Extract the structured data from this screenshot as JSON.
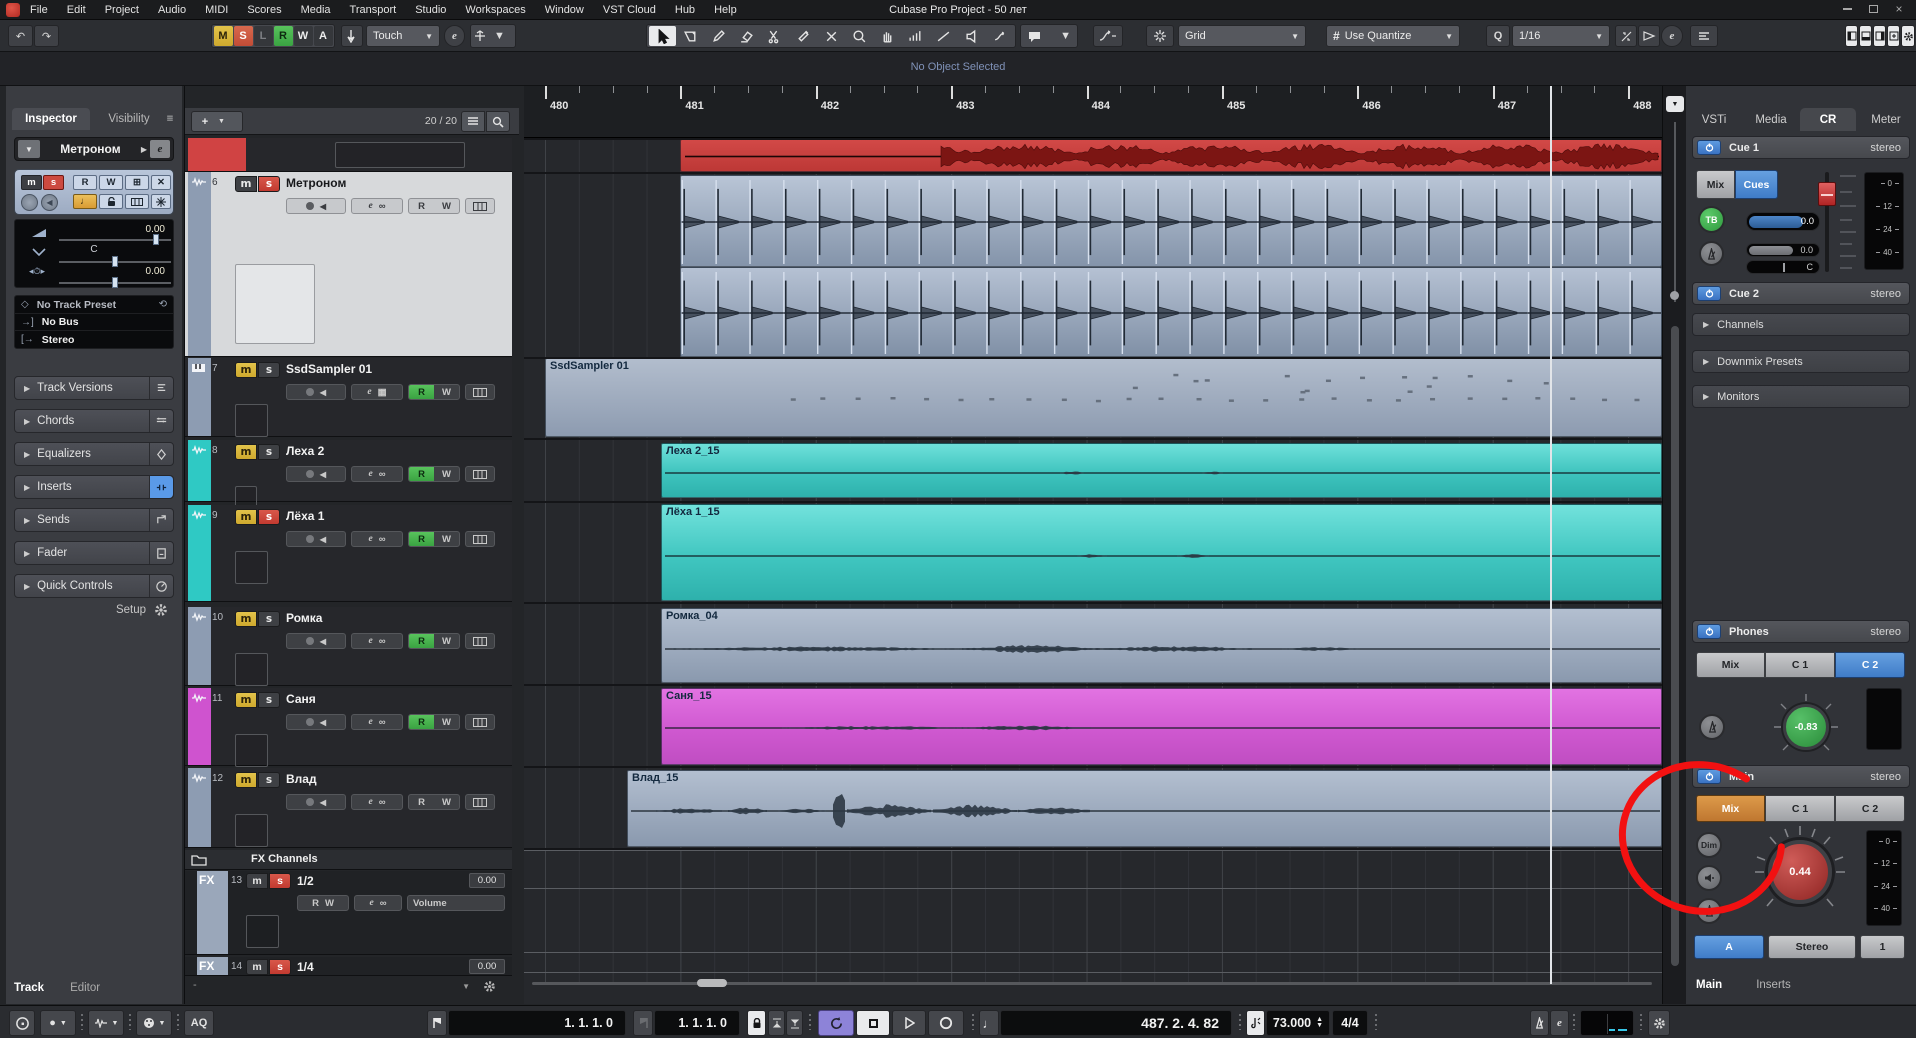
{
  "menubar": {
    "items": [
      "File",
      "Edit",
      "Project",
      "Audio",
      "MIDI",
      "Scores",
      "Media",
      "Transport",
      "Studio",
      "Workspaces",
      "Window",
      "VST Cloud",
      "Hub",
      "Help"
    ],
    "title": "Cubase Pro Project - 50 лет"
  },
  "toolbar": {
    "automation_buttons": [
      "M",
      "S",
      "L",
      "R",
      "W",
      "A"
    ],
    "automation_mode": "Touch",
    "edit_button": "e",
    "snap_type": "Grid",
    "quantize_toggle": "Use Quantize",
    "quantize_q": "Q",
    "quantize_value": "1/16"
  },
  "infoline": {
    "status": "No Object Selected"
  },
  "inspector": {
    "tabs": [
      "Inspector",
      "Visibility"
    ],
    "track_name": "Метроном",
    "edit_button": "e",
    "volume": "0.00",
    "pan": "C",
    "delay": "0.00",
    "routing": [
      "No Track Preset",
      "No Bus",
      "Stereo"
    ],
    "sections": [
      "Track Versions",
      "Chords",
      "Equalizers",
      "Inserts",
      "Sends",
      "Fader",
      "Quick Controls"
    ],
    "setup_label": "Setup",
    "bottom_tabs": [
      "Track",
      "Editor"
    ]
  },
  "tracklist": {
    "add_label": "+",
    "count": "20 / 20",
    "tracks": [
      {
        "num": "6",
        "name": "Метроном",
        "color": "#8d9cb2",
        "icon": "audio",
        "selected": true,
        "mute_on": false,
        "solo_on": true,
        "read_on": false,
        "lower": "ms"
      },
      {
        "num": "7",
        "name": "SsdSampler 01",
        "color": "#8d9cb2",
        "icon": "instrument",
        "selected": false,
        "mute_on": true,
        "solo_on": false,
        "read_on": true,
        "lower": "MS"
      },
      {
        "num": "8",
        "name": "Леха 2",
        "color": "#2fc9c4",
        "icon": "audio",
        "selected": false,
        "mute_on": true,
        "solo_on": false,
        "read_on": true,
        "lower": "MS"
      },
      {
        "num": "9",
        "name": "Лёха 1",
        "color": "#2fc9c4",
        "icon": "audio",
        "selected": false,
        "mute_on": true,
        "solo_on": true,
        "read_on": true,
        "lower": "MS"
      },
      {
        "num": "10",
        "name": "Ромка",
        "color": "#8d9cb2",
        "icon": "audio",
        "selected": false,
        "mute_on": true,
        "solo_on": false,
        "read_on": true,
        "lower": "MS"
      },
      {
        "num": "11",
        "name": "Саня",
        "color": "#cf53cf",
        "icon": "audio",
        "selected": false,
        "mute_on": true,
        "solo_on": false,
        "read_on": true,
        "lower": "MS"
      },
      {
        "num": "12",
        "name": "Влад",
        "color": "#8d9cb2",
        "icon": "audio",
        "selected": false,
        "mute_on": true,
        "solo_on": false,
        "read_on": false,
        "lower": "MS"
      }
    ],
    "folder_name": "FX Channels",
    "fx_tracks": [
      {
        "num": "13",
        "name": "1/2",
        "value": "0.00",
        "param": "Volume",
        "solo_on": true
      },
      {
        "num": "14",
        "name": "1/4",
        "value": "0.00",
        "solo_on": true
      }
    ]
  },
  "arrange": {
    "ruler_bars": [
      "480",
      "481",
      "482",
      "483",
      "484",
      "485",
      "486",
      "487",
      "488"
    ],
    "events": {
      "sampler": "SsdSampler 01",
      "leha2": "Леха 2_15",
      "leha1": "Лёха 1_15",
      "romka": "Ромка_04",
      "sanya": "Саня_15",
      "vlad": "Влад_15"
    }
  },
  "rightpanel": {
    "tabs": [
      "VSTi",
      "Media",
      "CR",
      "Meter"
    ],
    "cue1": {
      "label": "Cue 1",
      "mode": "stereo",
      "mix": "Mix",
      "cues": "Cues",
      "talkback": "TB",
      "level": "0.0",
      "click_level": "0.0",
      "pan": "C"
    },
    "cue2": {
      "label": "Cue 2",
      "mode": "stereo"
    },
    "collapsed": [
      "Channels",
      "Downmix Presets",
      "Monitors"
    ],
    "phones": {
      "label": "Phones",
      "mode": "stereo",
      "buttons": [
        "Mix",
        "C 1",
        "C 2"
      ],
      "knob": "-0.83"
    },
    "main": {
      "label": "Main",
      "mode": "stereo",
      "buttons": [
        "Mix",
        "C 1",
        "C 2"
      ],
      "dim": "Dim",
      "knob": "0.44",
      "output": [
        "A",
        "Stereo",
        "1"
      ]
    },
    "meter_ticks": [
      "0",
      "12",
      "24",
      "40"
    ],
    "bottom_tabs": [
      "Main",
      "Inserts"
    ]
  },
  "transport": {
    "aq_label": "AQ",
    "left_locator": "1. 1. 1. 0",
    "right_locator": "1. 1. 1. 0",
    "position": "487. 2. 4. 82",
    "tempo": "73.000",
    "signature": "4/4",
    "edit_button": "e"
  },
  "annotation": {
    "color": "#f21111"
  }
}
